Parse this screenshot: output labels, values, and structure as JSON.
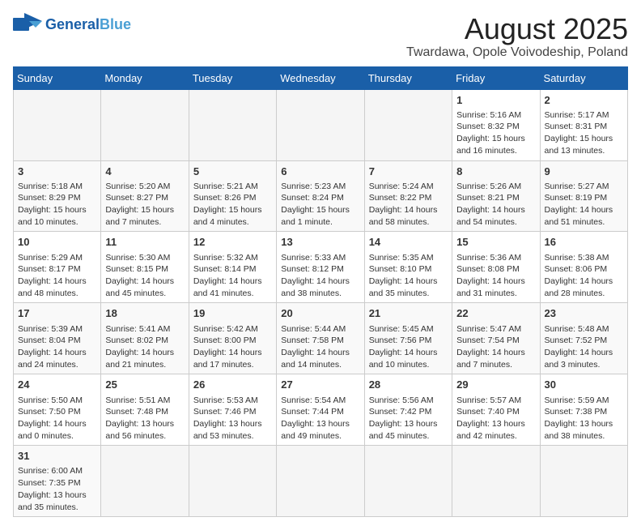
{
  "header": {
    "logo_general": "General",
    "logo_blue": "Blue",
    "month_title": "August 2025",
    "location": "Twardawa, Opole Voivodeship, Poland"
  },
  "days_of_week": [
    "Sunday",
    "Monday",
    "Tuesday",
    "Wednesday",
    "Thursday",
    "Friday",
    "Saturday"
  ],
  "weeks": [
    {
      "cells": [
        {
          "day": "",
          "empty": true
        },
        {
          "day": "",
          "empty": true
        },
        {
          "day": "",
          "empty": true
        },
        {
          "day": "",
          "empty": true
        },
        {
          "day": "",
          "empty": true
        },
        {
          "day": "1",
          "sunrise": "Sunrise: 5:16 AM",
          "sunset": "Sunset: 8:32 PM",
          "daylight": "Daylight: 15 hours and 16 minutes."
        },
        {
          "day": "2",
          "sunrise": "Sunrise: 5:17 AM",
          "sunset": "Sunset: 8:31 PM",
          "daylight": "Daylight: 15 hours and 13 minutes."
        }
      ]
    },
    {
      "cells": [
        {
          "day": "3",
          "sunrise": "Sunrise: 5:18 AM",
          "sunset": "Sunset: 8:29 PM",
          "daylight": "Daylight: 15 hours and 10 minutes."
        },
        {
          "day": "4",
          "sunrise": "Sunrise: 5:20 AM",
          "sunset": "Sunset: 8:27 PM",
          "daylight": "Daylight: 15 hours and 7 minutes."
        },
        {
          "day": "5",
          "sunrise": "Sunrise: 5:21 AM",
          "sunset": "Sunset: 8:26 PM",
          "daylight": "Daylight: 15 hours and 4 minutes."
        },
        {
          "day": "6",
          "sunrise": "Sunrise: 5:23 AM",
          "sunset": "Sunset: 8:24 PM",
          "daylight": "Daylight: 15 hours and 1 minute."
        },
        {
          "day": "7",
          "sunrise": "Sunrise: 5:24 AM",
          "sunset": "Sunset: 8:22 PM",
          "daylight": "Daylight: 14 hours and 58 minutes."
        },
        {
          "day": "8",
          "sunrise": "Sunrise: 5:26 AM",
          "sunset": "Sunset: 8:21 PM",
          "daylight": "Daylight: 14 hours and 54 minutes."
        },
        {
          "day": "9",
          "sunrise": "Sunrise: 5:27 AM",
          "sunset": "Sunset: 8:19 PM",
          "daylight": "Daylight: 14 hours and 51 minutes."
        }
      ]
    },
    {
      "cells": [
        {
          "day": "10",
          "sunrise": "Sunrise: 5:29 AM",
          "sunset": "Sunset: 8:17 PM",
          "daylight": "Daylight: 14 hours and 48 minutes."
        },
        {
          "day": "11",
          "sunrise": "Sunrise: 5:30 AM",
          "sunset": "Sunset: 8:15 PM",
          "daylight": "Daylight: 14 hours and 45 minutes."
        },
        {
          "day": "12",
          "sunrise": "Sunrise: 5:32 AM",
          "sunset": "Sunset: 8:14 PM",
          "daylight": "Daylight: 14 hours and 41 minutes."
        },
        {
          "day": "13",
          "sunrise": "Sunrise: 5:33 AM",
          "sunset": "Sunset: 8:12 PM",
          "daylight": "Daylight: 14 hours and 38 minutes."
        },
        {
          "day": "14",
          "sunrise": "Sunrise: 5:35 AM",
          "sunset": "Sunset: 8:10 PM",
          "daylight": "Daylight: 14 hours and 35 minutes."
        },
        {
          "day": "15",
          "sunrise": "Sunrise: 5:36 AM",
          "sunset": "Sunset: 8:08 PM",
          "daylight": "Daylight: 14 hours and 31 minutes."
        },
        {
          "day": "16",
          "sunrise": "Sunrise: 5:38 AM",
          "sunset": "Sunset: 8:06 PM",
          "daylight": "Daylight: 14 hours and 28 minutes."
        }
      ]
    },
    {
      "cells": [
        {
          "day": "17",
          "sunrise": "Sunrise: 5:39 AM",
          "sunset": "Sunset: 8:04 PM",
          "daylight": "Daylight: 14 hours and 24 minutes."
        },
        {
          "day": "18",
          "sunrise": "Sunrise: 5:41 AM",
          "sunset": "Sunset: 8:02 PM",
          "daylight": "Daylight: 14 hours and 21 minutes."
        },
        {
          "day": "19",
          "sunrise": "Sunrise: 5:42 AM",
          "sunset": "Sunset: 8:00 PM",
          "daylight": "Daylight: 14 hours and 17 minutes."
        },
        {
          "day": "20",
          "sunrise": "Sunrise: 5:44 AM",
          "sunset": "Sunset: 7:58 PM",
          "daylight": "Daylight: 14 hours and 14 minutes."
        },
        {
          "day": "21",
          "sunrise": "Sunrise: 5:45 AM",
          "sunset": "Sunset: 7:56 PM",
          "daylight": "Daylight: 14 hours and 10 minutes."
        },
        {
          "day": "22",
          "sunrise": "Sunrise: 5:47 AM",
          "sunset": "Sunset: 7:54 PM",
          "daylight": "Daylight: 14 hours and 7 minutes."
        },
        {
          "day": "23",
          "sunrise": "Sunrise: 5:48 AM",
          "sunset": "Sunset: 7:52 PM",
          "daylight": "Daylight: 14 hours and 3 minutes."
        }
      ]
    },
    {
      "cells": [
        {
          "day": "24",
          "sunrise": "Sunrise: 5:50 AM",
          "sunset": "Sunset: 7:50 PM",
          "daylight": "Daylight: 14 hours and 0 minutes."
        },
        {
          "day": "25",
          "sunrise": "Sunrise: 5:51 AM",
          "sunset": "Sunset: 7:48 PM",
          "daylight": "Daylight: 13 hours and 56 minutes."
        },
        {
          "day": "26",
          "sunrise": "Sunrise: 5:53 AM",
          "sunset": "Sunset: 7:46 PM",
          "daylight": "Daylight: 13 hours and 53 minutes."
        },
        {
          "day": "27",
          "sunrise": "Sunrise: 5:54 AM",
          "sunset": "Sunset: 7:44 PM",
          "daylight": "Daylight: 13 hours and 49 minutes."
        },
        {
          "day": "28",
          "sunrise": "Sunrise: 5:56 AM",
          "sunset": "Sunset: 7:42 PM",
          "daylight": "Daylight: 13 hours and 45 minutes."
        },
        {
          "day": "29",
          "sunrise": "Sunrise: 5:57 AM",
          "sunset": "Sunset: 7:40 PM",
          "daylight": "Daylight: 13 hours and 42 minutes."
        },
        {
          "day": "30",
          "sunrise": "Sunrise: 5:59 AM",
          "sunset": "Sunset: 7:38 PM",
          "daylight": "Daylight: 13 hours and 38 minutes."
        }
      ]
    },
    {
      "cells": [
        {
          "day": "31",
          "sunrise": "Sunrise: 6:00 AM",
          "sunset": "Sunset: 7:35 PM",
          "daylight": "Daylight: 13 hours and 35 minutes."
        },
        {
          "day": "",
          "empty": true
        },
        {
          "day": "",
          "empty": true
        },
        {
          "day": "",
          "empty": true
        },
        {
          "day": "",
          "empty": true
        },
        {
          "day": "",
          "empty": true
        },
        {
          "day": "",
          "empty": true
        }
      ]
    }
  ]
}
